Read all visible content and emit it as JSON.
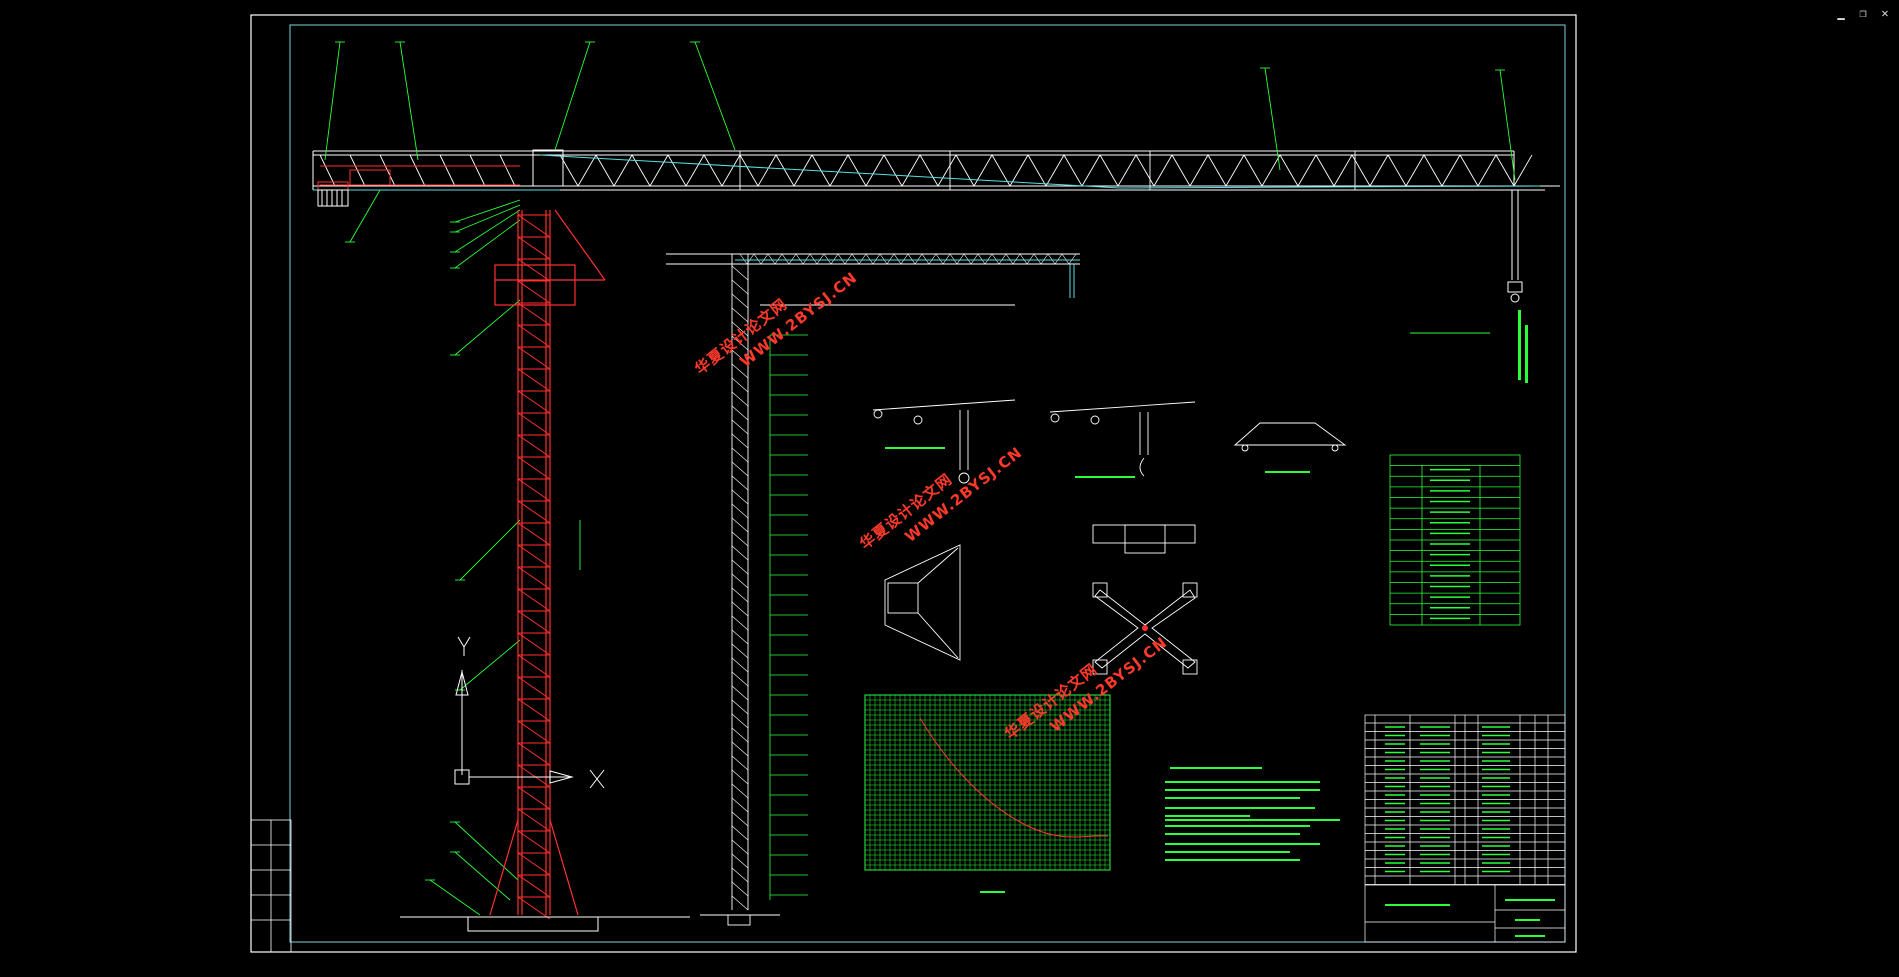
{
  "window": {
    "controls": {
      "minimize": "▁",
      "restore": "❐",
      "close": "✕"
    }
  },
  "drawing": {
    "watermark_cn": "华夏设计论文网",
    "watermark_url": "WWW.2BYSJ.CN",
    "axis_y": "Y",
    "axis_x": "X",
    "colors": {
      "background": "#000000",
      "frame": "#ffffff",
      "inner_frame": "#7fd1e0",
      "tower": "#ff3030",
      "jib": "#ffffff",
      "annotation": "#29ff3a",
      "cyan": "#55e0e0"
    }
  }
}
